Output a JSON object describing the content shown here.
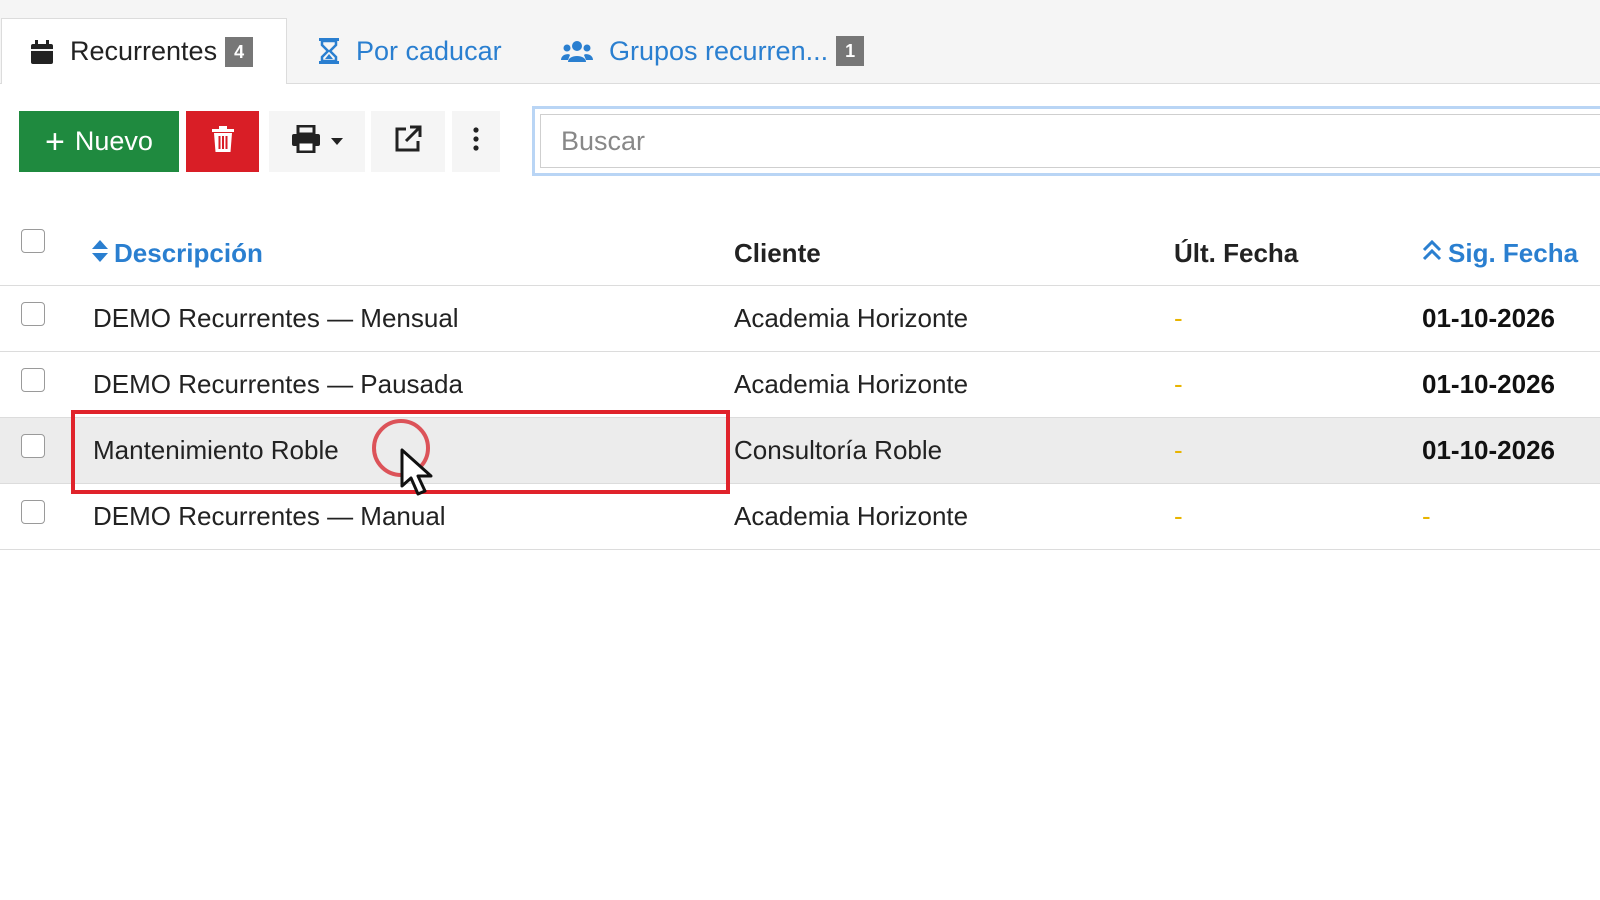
{
  "tabs": [
    {
      "label": "Recurrentes",
      "badge": "4",
      "icon": "calendar-icon",
      "active": true
    },
    {
      "label": "Por caducar",
      "icon": "hourglass-icon",
      "active": false
    },
    {
      "label": "Grupos recurren...",
      "badge": "1",
      "icon": "users-icon",
      "active": false
    }
  ],
  "toolbar": {
    "new_label": "Nuevo",
    "delete_icon": "trash-icon",
    "print_icon": "printer-icon",
    "export_icon": "external-link-icon",
    "more_icon": "vertical-dots-icon"
  },
  "search": {
    "placeholder": "Buscar",
    "value": ""
  },
  "table": {
    "columns": [
      {
        "label": "Descripción",
        "sort": "sortable"
      },
      {
        "label": "Cliente"
      },
      {
        "label": "Últ. Fecha"
      },
      {
        "label": "Sig. Fecha",
        "sort": "ascending"
      }
    ],
    "rows": [
      {
        "descripcion": "DEMO Recurrentes — Mensual",
        "cliente": "Academia Horizonte",
        "ult_fecha": "-",
        "sig_fecha": "01-10-2026"
      },
      {
        "descripcion": "DEMO Recurrentes — Pausada",
        "cliente": "Academia Horizonte",
        "ult_fecha": "-",
        "sig_fecha": "01-10-2026"
      },
      {
        "descripcion": "Mantenimiento Roble",
        "cliente": "Consultoría Roble",
        "ult_fecha": "-",
        "sig_fecha": "01-10-2026"
      },
      {
        "descripcion": "DEMO Recurrentes — Manual",
        "cliente": "Academia Horizonte",
        "ult_fecha": "-",
        "sig_fecha": "-"
      }
    ]
  },
  "colors": {
    "primary": "#2a7fd0",
    "success": "#1f8a3f",
    "danger": "#d91e26",
    "dash": "#e8b400",
    "highlight": "#e0232b"
  }
}
